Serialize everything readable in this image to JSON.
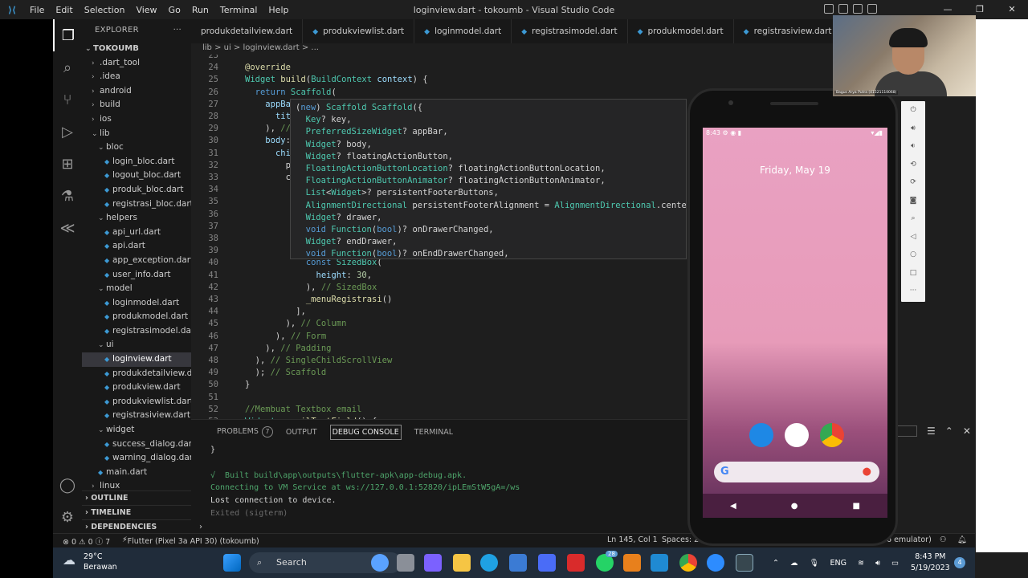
{
  "window": {
    "title": "loginview.dart - tokoumb - Visual Studio Code",
    "menu": [
      "File",
      "Edit",
      "Selection",
      "View",
      "Go",
      "Run",
      "Terminal",
      "Help"
    ]
  },
  "explorer": {
    "header": "EXPLORER",
    "root": "TOKOUMB",
    "items": [
      {
        "label": ".dart_tool",
        "indent": 1,
        "type": "folder-closed"
      },
      {
        "label": ".idea",
        "indent": 1,
        "type": "folder-closed"
      },
      {
        "label": "android",
        "indent": 1,
        "type": "folder-closed"
      },
      {
        "label": "build",
        "indent": 1,
        "type": "folder-closed"
      },
      {
        "label": "ios",
        "indent": 1,
        "type": "folder-closed"
      },
      {
        "label": "lib",
        "indent": 1,
        "type": "folder-open"
      },
      {
        "label": "bloc",
        "indent": 2,
        "type": "folder-open"
      },
      {
        "label": "login_bloc.dart",
        "indent": 3,
        "type": "file"
      },
      {
        "label": "logout_bloc.dart",
        "indent": 3,
        "type": "file"
      },
      {
        "label": "produk_bloc.dart",
        "indent": 3,
        "type": "file"
      },
      {
        "label": "registrasi_bloc.dart",
        "indent": 3,
        "type": "file"
      },
      {
        "label": "helpers",
        "indent": 2,
        "type": "folder-open"
      },
      {
        "label": "api_url.dart",
        "indent": 3,
        "type": "file"
      },
      {
        "label": "api.dart",
        "indent": 3,
        "type": "file"
      },
      {
        "label": "app_exception.dart",
        "indent": 3,
        "type": "file"
      },
      {
        "label": "user_info.dart",
        "indent": 3,
        "type": "file"
      },
      {
        "label": "model",
        "indent": 2,
        "type": "folder-open"
      },
      {
        "label": "loginmodel.dart",
        "indent": 3,
        "type": "file"
      },
      {
        "label": "produkmodel.dart",
        "indent": 3,
        "type": "file"
      },
      {
        "label": "registrasimodel.dart",
        "indent": 3,
        "type": "file"
      },
      {
        "label": "ui",
        "indent": 2,
        "type": "folder-open"
      },
      {
        "label": "loginview.dart",
        "indent": 3,
        "type": "file",
        "selected": true
      },
      {
        "label": "produkdetailview.d...",
        "indent": 3,
        "type": "file"
      },
      {
        "label": "produkview.dart",
        "indent": 3,
        "type": "file"
      },
      {
        "label": "produkviewlist.dart",
        "indent": 3,
        "type": "file"
      },
      {
        "label": "registrasiview.dart",
        "indent": 3,
        "type": "file"
      },
      {
        "label": "widget",
        "indent": 2,
        "type": "folder-open"
      },
      {
        "label": "success_dialog.dart",
        "indent": 3,
        "type": "file"
      },
      {
        "label": "warning_dialog.dart",
        "indent": 3,
        "type": "file"
      },
      {
        "label": "main.dart",
        "indent": 2,
        "type": "file"
      },
      {
        "label": "linux",
        "indent": 1,
        "type": "folder-closed"
      }
    ],
    "sections": [
      "OUTLINE",
      "TIMELINE",
      "DEPENDENCIES"
    ]
  },
  "tabs": [
    "produkdetailview.dart",
    "produkviewlist.dart",
    "loginmodel.dart",
    "registrasimodel.dart",
    "produkmodel.dart",
    "registrasiview.dart"
  ],
  "breadcrumb": "lib  >  ui  >  loginview.dart  >  ...",
  "code": [
    {
      "n": "23",
      "t": ""
    },
    {
      "n": "24",
      "t": "@override"
    },
    {
      "n": "25",
      "t": "Widget build(BuildContext context) {"
    },
    {
      "n": "26",
      "t": "  return Scaffold("
    },
    {
      "n": "27",
      "t": "    appBa"
    },
    {
      "n": "28",
      "t": "      tit"
    },
    {
      "n": "29",
      "t": "    ), //"
    },
    {
      "n": "30",
      "t": "    body:"
    },
    {
      "n": "31",
      "t": "      chi"
    },
    {
      "n": "32",
      "t": "        p"
    },
    {
      "n": "33",
      "t": "        c"
    },
    {
      "n": "34",
      "t": ""
    },
    {
      "n": "35",
      "t": ""
    },
    {
      "n": "36",
      "t": ""
    },
    {
      "n": "37",
      "t": ""
    },
    {
      "n": "38",
      "t": ""
    },
    {
      "n": "39",
      "t": ""
    },
    {
      "n": "40",
      "t": "            const SizedBox("
    },
    {
      "n": "41",
      "t": "              height: 30,"
    },
    {
      "n": "42",
      "t": "            ), // SizedBox"
    },
    {
      "n": "43",
      "t": "            _menuRegistrasi()"
    },
    {
      "n": "44",
      "t": "          ],"
    },
    {
      "n": "45",
      "t": "        ), // Column"
    },
    {
      "n": "46",
      "t": "      ), // Form"
    },
    {
      "n": "47",
      "t": "    ), // Padding"
    },
    {
      "n": "48",
      "t": "  ), // SingleChildScrollView"
    },
    {
      "n": "49",
      "t": "  ); // Scaffold"
    },
    {
      "n": "50",
      "t": "}"
    },
    {
      "n": "51",
      "t": ""
    },
    {
      "n": "52",
      "t": "//Membuat Textbox email"
    },
    {
      "n": "53",
      "t": "Widget _emailTextField() {"
    }
  ],
  "hover": [
    "(new) Scaffold Scaffold({",
    "  Key? key,",
    "  PreferredSizeWidget? appBar,",
    "  Widget? body,",
    "  Widget? floatingActionButton,",
    "  FloatingActionButtonLocation? floatingActionButtonLocation,",
    "  FloatingActionButtonAnimator? floatingActionButtonAnimator,",
    "  List<Widget>? persistentFooterButtons,",
    "  AlignmentDirectional persistentFooterAlignment = AlignmentDirectional.centerE",
    "  Widget? drawer,",
    "  void Function(bool)? onDrawerChanged,",
    "  Widget? endDrawer,",
    "  void Function(bool)? onEndDrawerChanged,"
  ],
  "panel": {
    "tabs": [
      "PROBLEMS",
      "OUTPUT",
      "DEBUG CONSOLE",
      "TERMINAL"
    ],
    "problems_count": "7",
    "active_tab": "DEBUG CONSOLE",
    "lines": [
      {
        "text": "}",
        "color": "#d4d4d4"
      },
      {
        "text": "",
        "color": "#d4d4d4"
      },
      {
        "text": "√  Built build\\app\\outputs\\flutter-apk\\app-debug.apk.",
        "color": "#4ea56b"
      },
      {
        "text": "Connecting to VM Service at ws://127.0.0.1:52820/ipLEmStW5gA=/ws",
        "color": "#4ea56b"
      },
      {
        "text": "Lost connection to device.",
        "color": "#d4d4d4"
      },
      {
        "text": "Exited (sigterm)",
        "color": "#6b6b6b"
      }
    ]
  },
  "statusbar": {
    "errors": "⊗ 0 ⚠ 0 ⓘ 7",
    "device": "Flutter (Pixel 3a API 30) (tokoumb)",
    "position": "Ln 145, Col 1",
    "spaces": "Spaces: 2",
    "emulator": "6 emulator)"
  },
  "emulator": {
    "time": "8:43",
    "date": "Friday, May 19"
  },
  "webcam": {
    "caption": "Bagus Arya Putra (41521110068)"
  },
  "taskbar": {
    "temp": "29°C",
    "weather": "Berawan",
    "search": "Search",
    "lang": "ENG",
    "time": "8:43 PM",
    "date": "5/19/2023",
    "whatsapp_badge": "28",
    "notifications": "4"
  }
}
